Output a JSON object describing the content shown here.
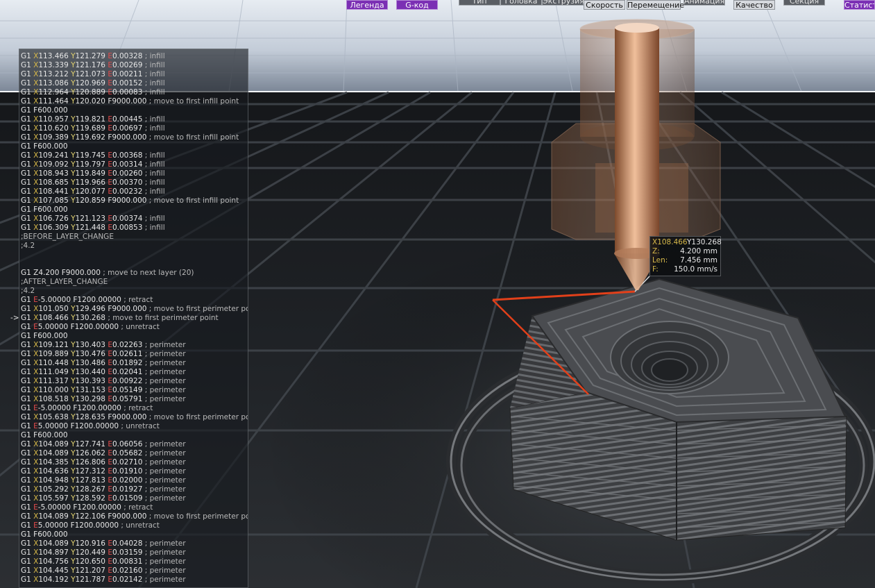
{
  "toolbar": {
    "legend": "Легенда",
    "gcode": "G-код",
    "type": "Тип",
    "head": "Головка",
    "extrusion": "Экструзия",
    "speed": "Скорость",
    "travel": "Перемещение",
    "animation": "Анимация",
    "quality": "Качество",
    "section": "Секция",
    "stats": "Статист"
  },
  "gcode_lines": [
    {
      "cmd": "G1 ",
      "x": "X113.466",
      "y": "Y121.279",
      "e": "E0.00328",
      "rest": "",
      "comment": "; infill"
    },
    {
      "cmd": "G1 ",
      "x": "X113.339",
      "y": "Y121.176",
      "e": "E0.00269",
      "rest": "",
      "comment": "; infill"
    },
    {
      "cmd": "G1 ",
      "x": "X113.212",
      "y": "Y121.073",
      "e": "E0.00211",
      "rest": "",
      "comment": "; infill"
    },
    {
      "cmd": "G1 ",
      "x": "X113.086",
      "y": "Y120.969",
      "e": "E0.00152",
      "rest": "",
      "comment": "; infill"
    },
    {
      "cmd": "G1 ",
      "x": "X112.964",
      "y": "Y120.889",
      "e": "E0.00083",
      "rest": "",
      "comment": "; infill"
    },
    {
      "cmd": "G1 ",
      "x": "X111.464",
      "y": "Y120.020",
      "e": "",
      "rest": "F9000.000",
      "comment": "; move to first infill point"
    },
    {
      "cmd": "G1 ",
      "x": "",
      "y": "",
      "e": "",
      "rest": "F600.000",
      "comment": ""
    },
    {
      "cmd": "G1 ",
      "x": "X110.957",
      "y": "Y119.821",
      "e": "E0.00445",
      "rest": "",
      "comment": "; infill"
    },
    {
      "cmd": "G1 ",
      "x": "X110.620",
      "y": "Y119.689",
      "e": "E0.00697",
      "rest": "",
      "comment": "; infill"
    },
    {
      "cmd": "G1 ",
      "x": "X109.389",
      "y": "Y119.692",
      "e": "",
      "rest": "F9000.000",
      "comment": "; move to first infill point"
    },
    {
      "cmd": "G1 ",
      "x": "",
      "y": "",
      "e": "",
      "rest": "F600.000",
      "comment": ""
    },
    {
      "cmd": "G1 ",
      "x": "X109.241",
      "y": "Y119.745",
      "e": "E0.00368",
      "rest": "",
      "comment": "; infill"
    },
    {
      "cmd": "G1 ",
      "x": "X109.092",
      "y": "Y119.797",
      "e": "E0.00314",
      "rest": "",
      "comment": "; infill"
    },
    {
      "cmd": "G1 ",
      "x": "X108.943",
      "y": "Y119.849",
      "e": "E0.00260",
      "rest": "",
      "comment": "; infill"
    },
    {
      "cmd": "G1 ",
      "x": "X108.685",
      "y": "Y119.966",
      "e": "E0.00370",
      "rest": "",
      "comment": "; infill"
    },
    {
      "cmd": "G1 ",
      "x": "X108.441",
      "y": "Y120.077",
      "e": "E0.00232",
      "rest": "",
      "comment": "; infill"
    },
    {
      "cmd": "G1 ",
      "x": "X107.085",
      "y": "Y120.859",
      "e": "",
      "rest": "F9000.000",
      "comment": "; move to first infill point"
    },
    {
      "cmd": "G1 ",
      "x": "",
      "y": "",
      "e": "",
      "rest": "F600.000",
      "comment": ""
    },
    {
      "cmd": "G1 ",
      "x": "X106.726",
      "y": "Y121.123",
      "e": "E0.00374",
      "rest": "",
      "comment": "; infill"
    },
    {
      "cmd": "G1 ",
      "x": "X106.309",
      "y": "Y121.448",
      "e": "E0.00853",
      "rest": "",
      "comment": "; infill"
    },
    {
      "cmd": "",
      "x": "",
      "y": "",
      "e": "",
      "rest": "",
      "comment": ";BEFORE_LAYER_CHANGE"
    },
    {
      "cmd": "",
      "x": "",
      "y": "",
      "e": "",
      "rest": "",
      "comment": ";4.2"
    },
    {
      "cmd": "",
      "x": "",
      "y": "",
      "e": "",
      "rest": "",
      "comment": ""
    },
    {
      "cmd": "",
      "x": "",
      "y": "",
      "e": "",
      "rest": "",
      "comment": ""
    },
    {
      "cmd": "G1 ",
      "x": "",
      "y": "",
      "e": "",
      "rest": "Z4.200 F9000.000",
      "comment": "; move to next layer (20)"
    },
    {
      "cmd": "",
      "x": "",
      "y": "",
      "e": "",
      "rest": "",
      "comment": ";AFTER_LAYER_CHANGE"
    },
    {
      "cmd": "",
      "x": "",
      "y": "",
      "e": "",
      "rest": "",
      "comment": ";4.2"
    },
    {
      "cmd": "G1 ",
      "x": "",
      "y": "",
      "e": "E-5.00000",
      "rest": "F1200.00000",
      "comment": "; retract"
    },
    {
      "cmd": "G1 ",
      "x": "X101.050",
      "y": "Y129.496",
      "e": "",
      "rest": "F9000.000",
      "comment": "; move to first perimeter point"
    },
    {
      "cmd": "G1 ",
      "x": "X108.466",
      "y": "Y130.268",
      "e": "",
      "rest": "",
      "comment": "; move to first perimeter point"
    },
    {
      "cmd": "G1 ",
      "x": "",
      "y": "",
      "e": "E5.00000",
      "rest": "F1200.00000",
      "comment": "; unretract"
    },
    {
      "cmd": "G1 ",
      "x": "",
      "y": "",
      "e": "",
      "rest": "F600.000",
      "comment": ""
    },
    {
      "cmd": "G1 ",
      "x": "X109.121",
      "y": "Y130.403",
      "e": "E0.02263",
      "rest": "",
      "comment": "; perimeter"
    },
    {
      "cmd": "G1 ",
      "x": "X109.889",
      "y": "Y130.476",
      "e": "E0.02611",
      "rest": "",
      "comment": "; perimeter"
    },
    {
      "cmd": "G1 ",
      "x": "X110.448",
      "y": "Y130.486",
      "e": "E0.01892",
      "rest": "",
      "comment": "; perimeter"
    },
    {
      "cmd": "G1 ",
      "x": "X111.049",
      "y": "Y130.440",
      "e": "E0.02041",
      "rest": "",
      "comment": "; perimeter"
    },
    {
      "cmd": "G1 ",
      "x": "X111.317",
      "y": "Y130.393",
      "e": "E0.00922",
      "rest": "",
      "comment": "; perimeter"
    },
    {
      "cmd": "G1 ",
      "x": "X110.000",
      "y": "Y131.153",
      "e": "E0.05149",
      "rest": "",
      "comment": "; perimeter"
    },
    {
      "cmd": "G1 ",
      "x": "X108.518",
      "y": "Y130.298",
      "e": "E0.05791",
      "rest": "",
      "comment": "; perimeter"
    },
    {
      "cmd": "G1 ",
      "x": "",
      "y": "",
      "e": "E-5.00000",
      "rest": "F1200.00000",
      "comment": "; retract"
    },
    {
      "cmd": "G1 ",
      "x": "X105.638",
      "y": "Y128.635",
      "e": "",
      "rest": "F9000.000",
      "comment": "; move to first perimeter point"
    },
    {
      "cmd": "G1 ",
      "x": "",
      "y": "",
      "e": "E5.00000",
      "rest": "F1200.00000",
      "comment": "; unretract"
    },
    {
      "cmd": "G1 ",
      "x": "",
      "y": "",
      "e": "",
      "rest": "F600.000",
      "comment": ""
    },
    {
      "cmd": "G1 ",
      "x": "X104.089",
      "y": "Y127.741",
      "e": "E0.06056",
      "rest": "",
      "comment": "; perimeter"
    },
    {
      "cmd": "G1 ",
      "x": "X104.089",
      "y": "Y126.062",
      "e": "E0.05682",
      "rest": "",
      "comment": "; perimeter"
    },
    {
      "cmd": "G1 ",
      "x": "X104.385",
      "y": "Y126.806",
      "e": "E0.02710",
      "rest": "",
      "comment": "; perimeter"
    },
    {
      "cmd": "G1 ",
      "x": "X104.636",
      "y": "Y127.312",
      "e": "E0.01910",
      "rest": "",
      "comment": "; perimeter"
    },
    {
      "cmd": "G1 ",
      "x": "X104.948",
      "y": "Y127.813",
      "e": "E0.02000",
      "rest": "",
      "comment": "; perimeter"
    },
    {
      "cmd": "G1 ",
      "x": "X105.292",
      "y": "Y128.267",
      "e": "E0.01927",
      "rest": "",
      "comment": "; perimeter"
    },
    {
      "cmd": "G1 ",
      "x": "X105.597",
      "y": "Y128.592",
      "e": "E0.01509",
      "rest": "",
      "comment": "; perimeter"
    },
    {
      "cmd": "G1 ",
      "x": "",
      "y": "",
      "e": "E-5.00000",
      "rest": "F1200.00000",
      "comment": "; retract"
    },
    {
      "cmd": "G1 ",
      "x": "X104.089",
      "y": "Y122.106",
      "e": "",
      "rest": "F9000.000",
      "comment": "; move to first perimeter point"
    },
    {
      "cmd": "G1 ",
      "x": "",
      "y": "",
      "e": "E5.00000",
      "rest": "F1200.00000",
      "comment": "; unretract"
    },
    {
      "cmd": "G1 ",
      "x": "",
      "y": "",
      "e": "",
      "rest": "F600.000",
      "comment": ""
    },
    {
      "cmd": "G1 ",
      "x": "X104.089",
      "y": "Y120.916",
      "e": "E0.04028",
      "rest": "",
      "comment": "; perimeter"
    },
    {
      "cmd": "G1 ",
      "x": "X104.897",
      "y": "Y120.449",
      "e": "E0.03159",
      "rest": "",
      "comment": "; perimeter"
    },
    {
      "cmd": "G1 ",
      "x": "X104.756",
      "y": "Y120.650",
      "e": "E0.00831",
      "rest": "",
      "comment": "; perimeter"
    },
    {
      "cmd": "G1 ",
      "x": "X104.445",
      "y": "Y121.207",
      "e": "E0.02160",
      "rest": "",
      "comment": "; perimeter"
    },
    {
      "cmd": "G1 ",
      "x": "X104.192",
      "y": "Y121.787",
      "e": "E0.02142",
      "rest": "",
      "comment": "; perimeter"
    }
  ],
  "current_marker": "->",
  "tooltip": {
    "x": "X108.466",
    "y": "Y130.268",
    "z_label": "Z:",
    "z_value": "4.200 mm",
    "len_label": "Len:",
    "len_value": "7.456 mm",
    "f_label": "F:",
    "f_value": "150.0 mm/s"
  },
  "colors": {
    "button_accent": "#7b2fb4",
    "travel_move": "#e2401a",
    "background": "#1a1c1f"
  }
}
